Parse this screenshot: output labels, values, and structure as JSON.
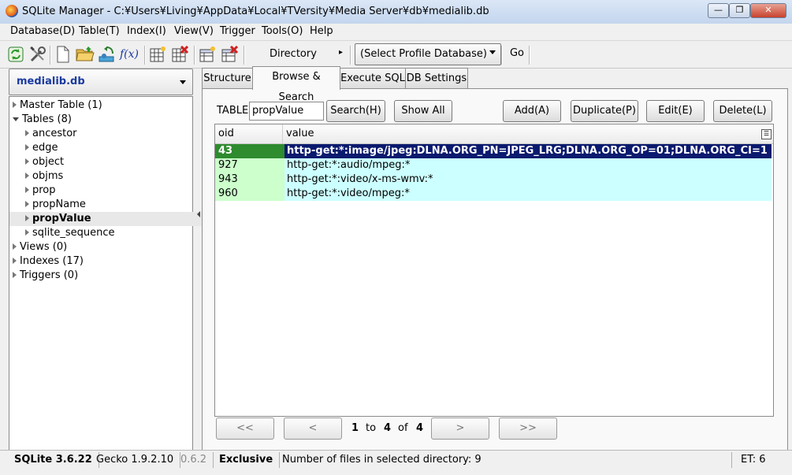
{
  "window": {
    "title": "SQLite Manager - C:¥Users¥Living¥AppData¥Local¥TVersity¥Media Server¥db¥medialib.db",
    "min": "—",
    "max": "❐",
    "close": "✕"
  },
  "menu": [
    "Database(D)",
    "Table(T)",
    "Index(I)",
    "View(V)",
    "Trigger",
    "Tools(O)",
    "Help"
  ],
  "toolbar": {
    "icons": [
      "refresh-icon",
      "tools-icon",
      "new-db-icon",
      "open-db-icon",
      "export-icon",
      "function-icon",
      "create-table-icon",
      "drop-table-icon",
      "create-index-icon",
      "drop-index-icon"
    ],
    "fx_label": "f(x)",
    "directory_label": "Directory",
    "directory_arrow": "▸",
    "profile_select": "(Select Profile Database)",
    "go_label": "Go"
  },
  "sidebar": {
    "database": "medialib.db",
    "tree": [
      {
        "label": "Master Table (1)",
        "level": 0,
        "open": false,
        "selected": false
      },
      {
        "label": "Tables (8)",
        "level": 0,
        "open": true,
        "selected": false
      },
      {
        "label": "ancestor",
        "level": 1,
        "open": false,
        "selected": false
      },
      {
        "label": "edge",
        "level": 1,
        "open": false,
        "selected": false
      },
      {
        "label": "object",
        "level": 1,
        "open": false,
        "selected": false
      },
      {
        "label": "objms",
        "level": 1,
        "open": false,
        "selected": false
      },
      {
        "label": "prop",
        "level": 1,
        "open": false,
        "selected": false
      },
      {
        "label": "propName",
        "level": 1,
        "open": false,
        "selected": false
      },
      {
        "label": "propValue",
        "level": 1,
        "open": false,
        "selected": true
      },
      {
        "label": "sqlite_sequence",
        "level": 1,
        "open": false,
        "selected": false
      },
      {
        "label": "Views (0)",
        "level": 0,
        "open": false,
        "selected": false
      },
      {
        "label": "Indexes (17)",
        "level": 0,
        "open": false,
        "selected": false
      },
      {
        "label": "Triggers (0)",
        "level": 0,
        "open": false,
        "selected": false
      }
    ]
  },
  "tabs": [
    "Structure",
    "Browse & Search",
    "Execute SQL",
    "DB Settings"
  ],
  "browse": {
    "table_label": "TABLE",
    "table_value": "propValue",
    "search_btn": "Search(H)",
    "showall_btn": "Show All",
    "add_btn": "Add(A)",
    "duplicate_btn": "Duplicate(P)",
    "edit_btn": "Edit(E)",
    "delete_btn": "Delete(L)",
    "columns": [
      "oid",
      "value"
    ],
    "rows": [
      {
        "oid": "43",
        "value": "http-get:*:image/jpeg:DLNA.ORG_PN=JPEG_LRG;DLNA.ORG_OP=01;DLNA.ORG_CI=1",
        "selected": true
      },
      {
        "oid": "927",
        "value": "http-get:*:audio/mpeg:*",
        "selected": false
      },
      {
        "oid": "943",
        "value": "http-get:*:video/x-ms-wmv:*",
        "selected": false
      },
      {
        "oid": "960",
        "value": "http-get:*:video/mpeg:*",
        "selected": false
      }
    ],
    "pager": {
      "first": "<<",
      "prev": "<",
      "from": "1",
      "to_label": "to",
      "to": "4",
      "of_label": "of",
      "total": "4",
      "next": ">",
      "last": ">>"
    }
  },
  "status": {
    "sqlite": "SQLite 3.6.22",
    "gecko": "Gecko 1.9.2.10",
    "version": "0.6.2",
    "mode": "Exclusive",
    "message": "Number of files in selected directory: 9",
    "et": "ET: 6"
  }
}
